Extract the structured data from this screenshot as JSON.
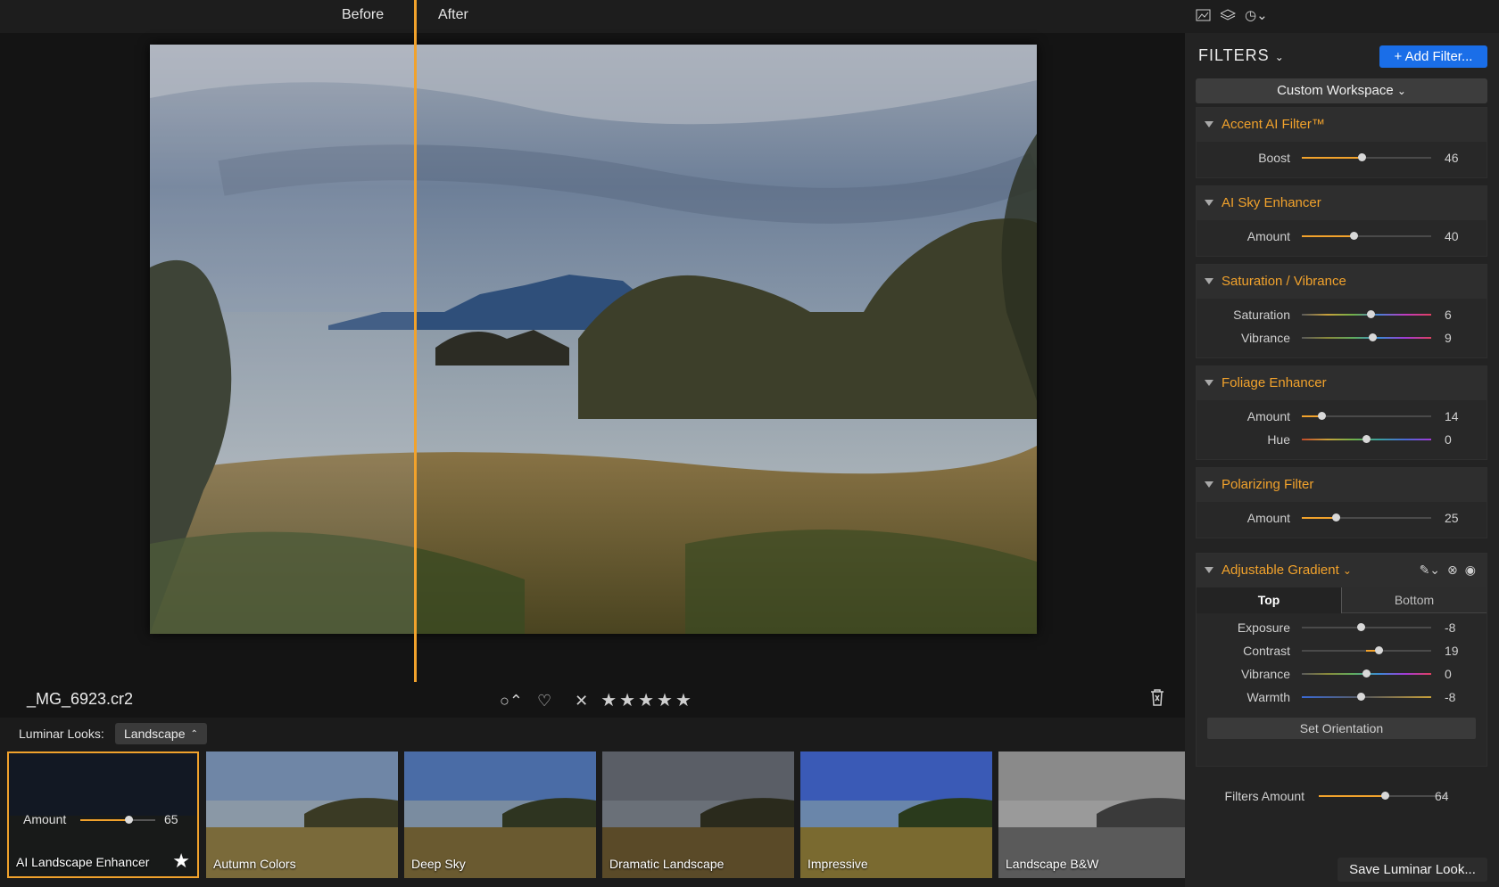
{
  "compare": {
    "before": "Before",
    "after": "After"
  },
  "file": {
    "name": "_MG_6923.cr2"
  },
  "looks": {
    "label": "Luminar Looks:",
    "selected": "Landscape",
    "items": [
      {
        "name": "AI Landscape Enhancer",
        "amount_label": "Amount",
        "amount": "65",
        "amount_fraction": 0.65
      },
      {
        "name": "Autumn Colors"
      },
      {
        "name": "Deep Sky"
      },
      {
        "name": "Dramatic Landscape"
      },
      {
        "name": "Impressive"
      },
      {
        "name": "Landscape B&W"
      }
    ]
  },
  "panel": {
    "title": "FILTERS",
    "add_filter": "+ Add Filter...",
    "workspace": "Custom Workspace",
    "filters": [
      {
        "title": "Accent AI Filter™",
        "sliders": [
          {
            "label": "Boost",
            "value": "46"
          }
        ]
      },
      {
        "title": "AI Sky Enhancer",
        "sliders": [
          {
            "label": "Amount",
            "value": "40"
          }
        ]
      },
      {
        "title": "Saturation / Vibrance",
        "sliders": [
          {
            "label": "Saturation",
            "value": "6"
          },
          {
            "label": "Vibrance",
            "value": "9"
          }
        ]
      },
      {
        "title": "Foliage Enhancer",
        "sliders": [
          {
            "label": "Amount",
            "value": "14"
          },
          {
            "label": "Hue",
            "value": "0"
          }
        ]
      },
      {
        "title": "Polarizing Filter",
        "sliders": [
          {
            "label": "Amount",
            "value": "25"
          }
        ]
      },
      {
        "title": "Adjustable Gradient",
        "tabs": [
          "Top",
          "Bottom"
        ],
        "sliders": [
          {
            "label": "Exposure",
            "value": "-8"
          },
          {
            "label": "Contrast",
            "value": "19"
          },
          {
            "label": "Vibrance",
            "value": "0"
          },
          {
            "label": "Warmth",
            "value": "-8"
          }
        ],
        "set_orientation": "Set Orientation"
      }
    ],
    "filters_amount": {
      "label": "Filters Amount",
      "value": "64"
    },
    "save_look": "Save Luminar Look..."
  },
  "colors": {
    "accent": "#f1a22c",
    "primary_button": "#1a6ee8"
  }
}
